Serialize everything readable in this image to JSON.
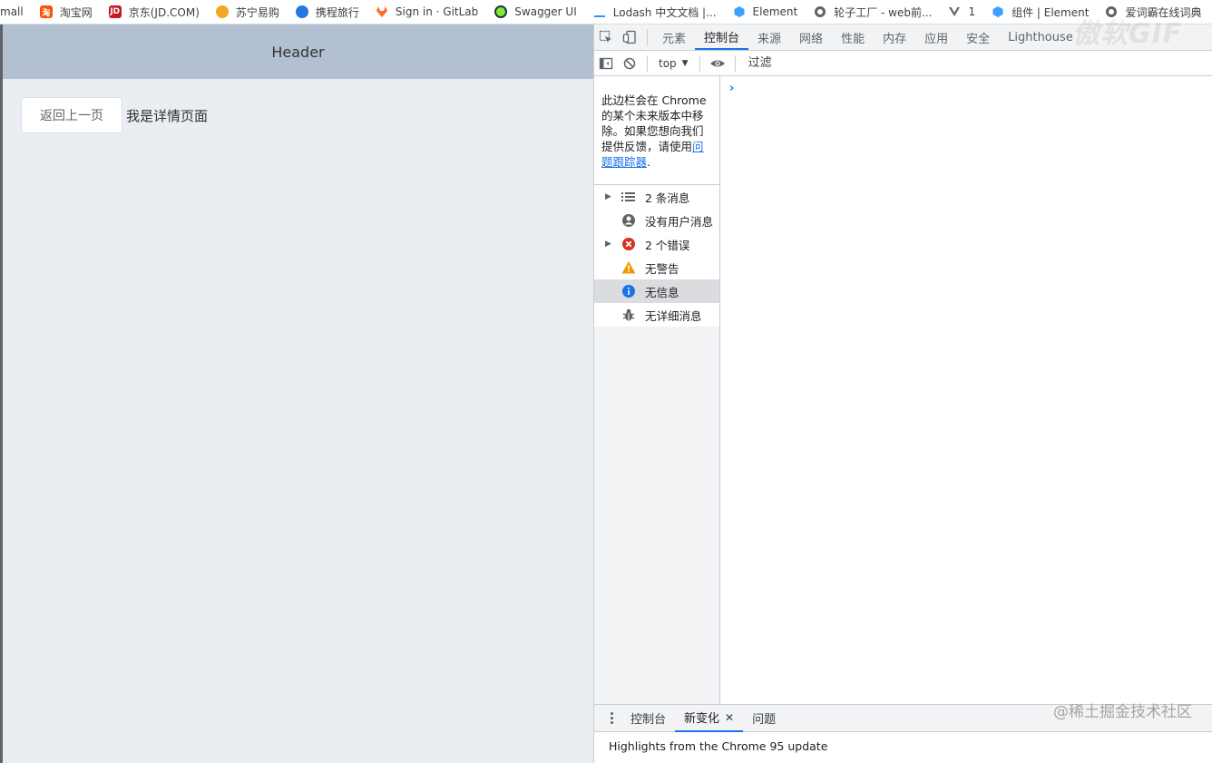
{
  "bookmarks": [
    {
      "label": "mall",
      "icon": "tmall-icon",
      "color": "#ffffff"
    },
    {
      "label": "淘宝网",
      "icon": "taobao-icon",
      "color": "#ff5000"
    },
    {
      "label": "京东(JD.COM)",
      "icon": "jd-icon",
      "color": "#c81623"
    },
    {
      "label": "苏宁易购",
      "icon": "suning-icon",
      "color": "#f5a623"
    },
    {
      "label": "携程旅行",
      "icon": "ctrip-icon",
      "color": "#2577e3"
    },
    {
      "label": "Sign in · GitLab",
      "icon": "gitlab-icon",
      "color": "#fc6d26"
    },
    {
      "label": "Swagger UI",
      "icon": "swagger-icon",
      "color": "#85ea2d"
    },
    {
      "label": "Lodash 中文文档 |...",
      "icon": "lodash-icon",
      "color": "#3492ff"
    },
    {
      "label": "Element",
      "icon": "element-icon",
      "color": "#409eff"
    },
    {
      "label": "轮子工厂 - web前...",
      "icon": "globe-icon",
      "color": "#5f6368"
    },
    {
      "label": "1",
      "icon": "vue-icon",
      "color": "#5f6368"
    },
    {
      "label": "组件 | Element",
      "icon": "element-icon",
      "color": "#409eff"
    },
    {
      "label": "爱词霸在线词典",
      "icon": "globe-icon",
      "color": "#5f6368"
    }
  ],
  "watermark": "傲软GIF",
  "page": {
    "header": "Header",
    "back_button": "返回上一页",
    "detail_text": "我是详情页面"
  },
  "devtools": {
    "tabs": [
      "元素",
      "控制台",
      "来源",
      "网络",
      "性能",
      "内存",
      "应用",
      "安全",
      "Lighthouse"
    ],
    "active_tab": "控制台",
    "context": "top",
    "filter_placeholder": "过滤",
    "sidebar_notice": "此边栏会在 Chrome 的某个未来版本中移除。如果您想向我们提供反馈，请使用",
    "sidebar_notice_link": "问题跟踪器",
    "sidebar_notice_end": ".",
    "sidebar_items": [
      {
        "label": "2 条消息",
        "icon": "list-icon",
        "expandable": true
      },
      {
        "label": "没有用户消息",
        "icon": "user-icon",
        "expandable": false
      },
      {
        "label": "2 个错误",
        "icon": "error-icon",
        "expandable": true
      },
      {
        "label": "无警告",
        "icon": "warning-icon",
        "expandable": false
      },
      {
        "label": "无信息",
        "icon": "info-icon",
        "expandable": false,
        "selected": true
      },
      {
        "label": "无详细消息",
        "icon": "bug-icon",
        "expandable": false
      }
    ],
    "prompt": "›",
    "drawer_tabs": [
      {
        "label": "控制台"
      },
      {
        "label": "新变化",
        "active": true,
        "closable": true
      },
      {
        "label": "问题"
      }
    ],
    "drawer_content": "Highlights from the Chrome 95 update"
  },
  "juejin_watermark": "@稀土掘金技术社区"
}
